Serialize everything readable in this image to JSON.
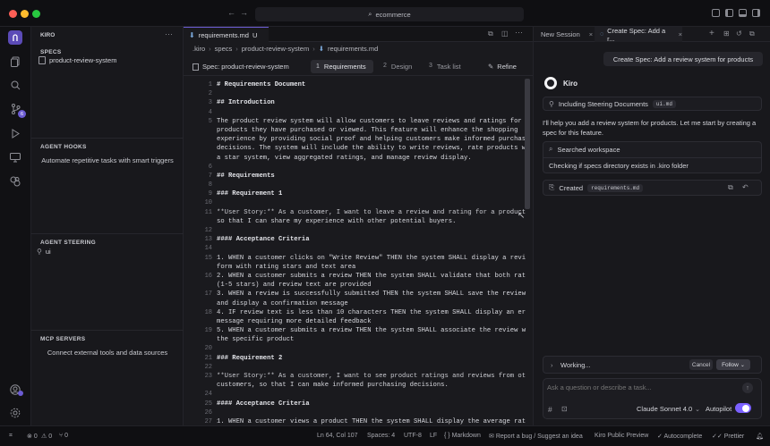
{
  "titlebar": {
    "search_text": "ecommerce"
  },
  "sidebar": {
    "title": "KIRO",
    "specs_header": "SPECS",
    "spec_item": "product-review-system",
    "hooks_header": "AGENT HOOKS",
    "hooks_text": "Automate repetitive tasks with smart triggers",
    "steering_header": "AGENT STEERING",
    "steering_item": "ui",
    "mcp_header": "MCP SERVERS",
    "mcp_text": "Connect external tools and data sources",
    "badge_count": "6"
  },
  "editor": {
    "tab_label": "requirements.md",
    "tab_modified": "U",
    "breadcrumb": [
      ".kiro",
      "specs",
      "product-review-system",
      "requirements.md"
    ],
    "spec_label": "Spec: product-review-system",
    "steps": [
      {
        "num": "1",
        "label": "Requirements"
      },
      {
        "num": "2",
        "label": "Design"
      },
      {
        "num": "3",
        "label": "Task list"
      }
    ],
    "refine_label": "Refine",
    "lines": [
      {
        "n": "1",
        "t": "# Requirements Document"
      },
      {
        "n": "2",
        "t": ""
      },
      {
        "n": "3",
        "t": "## Introduction"
      },
      {
        "n": "4",
        "t": ""
      },
      {
        "n": "5",
        "t": "The product review system will allow customers to leave reviews and ratings for"
      },
      {
        "n": "",
        "t": "products they have purchased or viewed. This feature will enhance the shopping"
      },
      {
        "n": "",
        "t": "experience by providing social proof and helping customers make informed purchasing"
      },
      {
        "n": "",
        "t": "decisions. The system will include the ability to write reviews, rate products with"
      },
      {
        "n": "",
        "t": "a star system, view aggregated ratings, and manage review display."
      },
      {
        "n": "6",
        "t": ""
      },
      {
        "n": "7",
        "t": "## Requirements"
      },
      {
        "n": "8",
        "t": ""
      },
      {
        "n": "9",
        "t": "### Requirement 1"
      },
      {
        "n": "10",
        "t": ""
      },
      {
        "n": "11",
        "t": "**User Story:** As a customer, I want to leave a review and rating for a product,"
      },
      {
        "n": "",
        "t": "so that I can share my experience with other potential buyers."
      },
      {
        "n": "12",
        "t": ""
      },
      {
        "n": "13",
        "t": "#### Acceptance Criteria"
      },
      {
        "n": "14",
        "t": ""
      },
      {
        "n": "15",
        "t": "1. WHEN a customer clicks on \"Write Review\" THEN the system SHALL display a review"
      },
      {
        "n": "",
        "t": "form with rating stars and text area"
      },
      {
        "n": "16",
        "t": "2. WHEN a customer submits a review THEN the system SHALL validate that both rating"
      },
      {
        "n": "",
        "t": "(1-5 stars) and review text are provided"
      },
      {
        "n": "17",
        "t": "3. WHEN a review is successfully submitted THEN the system SHALL save the review"
      },
      {
        "n": "",
        "t": "and display a confirmation message"
      },
      {
        "n": "18",
        "t": "4. IF review text is less than 10 characters THEN the system SHALL display an error"
      },
      {
        "n": "",
        "t": "message requiring more detailed feedback"
      },
      {
        "n": "19",
        "t": "5. WHEN a customer submits a review THEN the system SHALL associate the review with"
      },
      {
        "n": "",
        "t": "the specific product"
      },
      {
        "n": "20",
        "t": ""
      },
      {
        "n": "21",
        "t": "### Requirement 2"
      },
      {
        "n": "22",
        "t": ""
      },
      {
        "n": "23",
        "t": "**User Story:** As a customer, I want to see product ratings and reviews from other"
      },
      {
        "n": "",
        "t": "customers, so that I can make informed purchasing decisions."
      },
      {
        "n": "24",
        "t": ""
      },
      {
        "n": "25",
        "t": "#### Acceptance Criteria"
      },
      {
        "n": "26",
        "t": ""
      },
      {
        "n": "27",
        "t": "1. WHEN a customer views a product THEN the system SHALL display the average rating"
      }
    ]
  },
  "chat": {
    "tab1": "New Session",
    "tab2": "Create Spec: Add a r...",
    "user_message": "Create Spec: Add a review system for products",
    "assistant_name": "Kiro",
    "steering_label": "Including Steering Documents",
    "steering_file": "ui.md",
    "reply": "I'll help you add a review system for products. Let me start by creating a spec for this feature.",
    "searched_label": "Searched workspace",
    "searched_detail": "Checking if specs directory exists in .kiro folder",
    "created_label": "Created",
    "created_file": "requirements.md",
    "working_label": "Working...",
    "cancel_label": "Cancel",
    "follow_label": "Follow",
    "input_placeholder": "Ask a question or describe a task...",
    "model_label": "Claude Sonnet 4.0",
    "autopilot_label": "Autopilot"
  },
  "status": {
    "errors": "0",
    "warnings": "0",
    "ports": "0",
    "position": "Ln 64, Col 107",
    "spaces": "Spaces: 4",
    "encoding": "UTF-8",
    "eol": "LF",
    "language": "Markdown",
    "report": "Report a bug / Suggest an idea",
    "preview": "Kiro Public Preview",
    "autocomplete": "Autocomplete",
    "prettier": "Prettier"
  }
}
